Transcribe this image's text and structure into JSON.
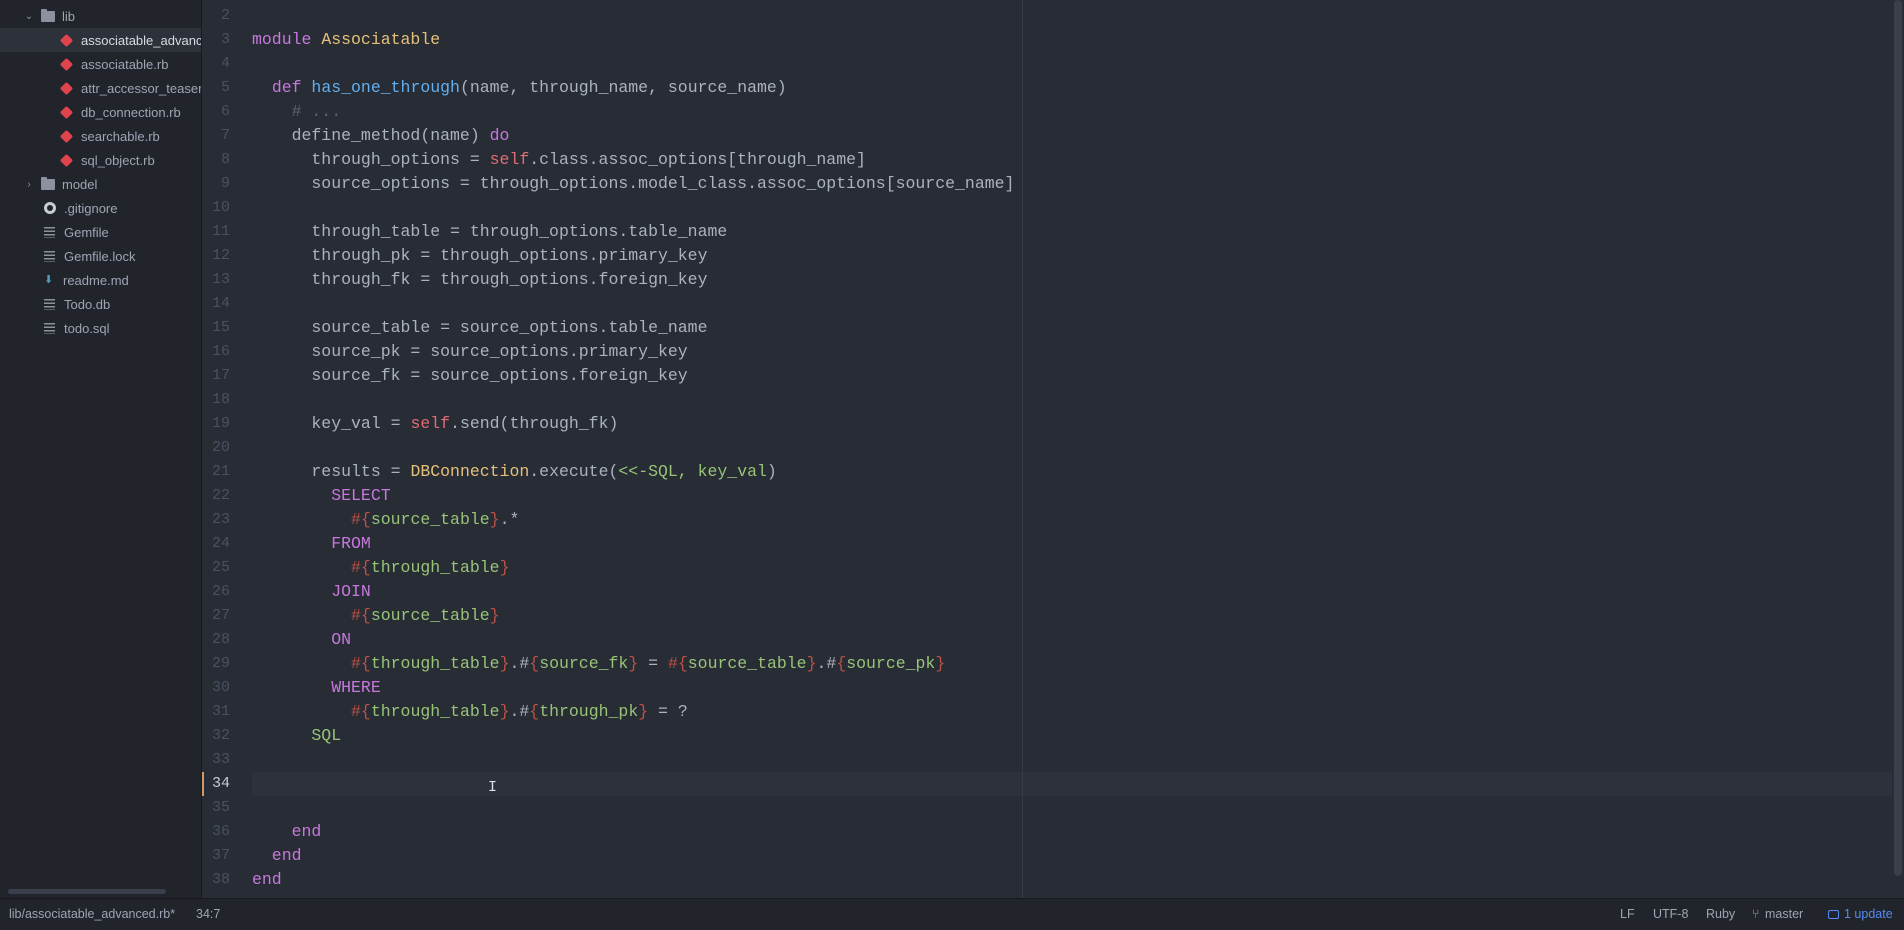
{
  "sidebar": {
    "items": [
      {
        "label": "lib",
        "type": "folder",
        "expanded": true
      },
      {
        "label": "associatable_advanced.rb",
        "type": "ruby",
        "selected": true
      },
      {
        "label": "associatable.rb",
        "type": "ruby"
      },
      {
        "label": "attr_accessor_teaser.rb",
        "type": "ruby"
      },
      {
        "label": "db_connection.rb",
        "type": "ruby"
      },
      {
        "label": "searchable.rb",
        "type": "ruby"
      },
      {
        "label": "sql_object.rb",
        "type": "ruby"
      },
      {
        "label": "model",
        "type": "folder",
        "expanded": false
      },
      {
        "label": ".gitignore",
        "type": "github"
      },
      {
        "label": "Gemfile",
        "type": "file"
      },
      {
        "label": "Gemfile.lock",
        "type": "file"
      },
      {
        "label": "readme.md",
        "type": "markdown"
      },
      {
        "label": "Todo.db",
        "type": "file"
      },
      {
        "label": "todo.sql",
        "type": "file"
      }
    ]
  },
  "editor": {
    "line_numbers": [
      "2",
      "3",
      "4",
      "5",
      "6",
      "7",
      "8",
      "9",
      "10",
      "11",
      "12",
      "13",
      "14",
      "15",
      "16",
      "17",
      "18",
      "19",
      "20",
      "21",
      "22",
      "23",
      "24",
      "25",
      "26",
      "27",
      "28",
      "29",
      "30",
      "31",
      "32",
      "33",
      "34",
      "35",
      "36",
      "37",
      "38"
    ],
    "active_line": "34",
    "lines": [
      [],
      [
        [
          "kw",
          "module "
        ],
        [
          "cls",
          "Associatable"
        ]
      ],
      [],
      [
        [
          "",
          "  "
        ],
        [
          "kw",
          "def "
        ],
        [
          "fn",
          "has_one_through"
        ],
        [
          "",
          "(name, through_name, source_name)"
        ]
      ],
      [
        [
          "cm",
          "    # ..."
        ]
      ],
      [
        [
          "",
          "    define_method(name) "
        ],
        [
          "kw",
          "do"
        ]
      ],
      [
        [
          "",
          "      through_options = "
        ],
        [
          "self",
          "self"
        ],
        [
          "",
          ".class.assoc_options[through_name]"
        ]
      ],
      [
        [
          "",
          "      source_options = through_options.model_class.assoc_options[source_name]"
        ]
      ],
      [],
      [
        [
          "",
          "      through_table = through_options.table_name"
        ]
      ],
      [
        [
          "",
          "      through_pk = through_options.primary_key"
        ]
      ],
      [
        [
          "",
          "      through_fk = through_options.foreign_key"
        ]
      ],
      [],
      [
        [
          "",
          "      source_table = source_options.table_name"
        ]
      ],
      [
        [
          "",
          "      source_pk = source_options.primary_key"
        ]
      ],
      [
        [
          "",
          "      source_fk = source_options.foreign_key"
        ]
      ],
      [],
      [
        [
          "",
          "      key_val = "
        ],
        [
          "self",
          "self"
        ],
        [
          "",
          ".send(through_fk)"
        ]
      ],
      [],
      [
        [
          "",
          "      results = "
        ],
        [
          "cls",
          "DBConnection"
        ],
        [
          "",
          ".execute("
        ],
        [
          "str",
          "<<-SQL, key_val"
        ],
        [
          "",
          ")"
        ]
      ],
      [
        [
          "kw",
          "        SELECT"
        ]
      ],
      [
        [
          "",
          "          "
        ],
        [
          "interp",
          "#{"
        ],
        [
          "str",
          "source_table"
        ],
        [
          "interp",
          "}"
        ],
        [
          "",
          ".*"
        ]
      ],
      [
        [
          "kw",
          "        FROM"
        ]
      ],
      [
        [
          "",
          "          "
        ],
        [
          "interp",
          "#{"
        ],
        [
          "str",
          "through_table"
        ],
        [
          "interp",
          "}"
        ]
      ],
      [
        [
          "kw",
          "        JOIN"
        ]
      ],
      [
        [
          "",
          "          "
        ],
        [
          "interp",
          "#{"
        ],
        [
          "str",
          "source_table"
        ],
        [
          "interp",
          "}"
        ]
      ],
      [
        [
          "kw",
          "        ON"
        ]
      ],
      [
        [
          "",
          "          "
        ],
        [
          "interp",
          "#{"
        ],
        [
          "str",
          "through_table"
        ],
        [
          "interp",
          "}"
        ],
        [
          "",
          ".#"
        ],
        [
          "interp",
          "{"
        ],
        [
          "str",
          "source_fk"
        ],
        [
          "interp",
          "}"
        ],
        [
          "",
          " = "
        ],
        [
          "interp",
          "#{"
        ],
        [
          "str",
          "source_table"
        ],
        [
          "interp",
          "}"
        ],
        [
          "",
          ".#"
        ],
        [
          "interp",
          "{"
        ],
        [
          "str",
          "source_pk"
        ],
        [
          "interp",
          "}"
        ]
      ],
      [
        [
          "kw",
          "        WHERE"
        ]
      ],
      [
        [
          "",
          "          "
        ],
        [
          "interp",
          "#{"
        ],
        [
          "str",
          "through_table"
        ],
        [
          "interp",
          "}"
        ],
        [
          "",
          ".#"
        ],
        [
          "interp",
          "{"
        ],
        [
          "str",
          "through_pk"
        ],
        [
          "interp",
          "}"
        ],
        [
          "",
          " = ?"
        ]
      ],
      [
        [
          "str",
          "      SQL"
        ]
      ],
      [],
      [],
      [],
      [
        [
          "kw",
          "    end"
        ]
      ],
      [
        [
          "kw",
          "  end"
        ]
      ],
      [
        [
          "kw",
          "end"
        ]
      ]
    ]
  },
  "status_bar": {
    "file_path": "lib/associatable_advanced.rb*",
    "cursor_position": "34:7",
    "line_ending": "LF",
    "encoding": "UTF-8",
    "grammar": "Ruby",
    "branch": "master",
    "updates": "1 update"
  },
  "colors": {
    "keyword": "#c678dd",
    "class": "#e5c07b",
    "function": "#61afef",
    "comment": "#5c6370",
    "self": "#e06c75",
    "string": "#98c379",
    "interpolation": "#be5046",
    "accent": "#568af2"
  }
}
